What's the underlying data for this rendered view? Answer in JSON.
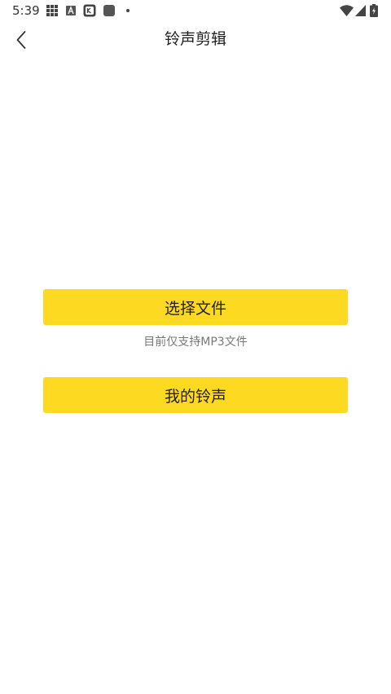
{
  "status_bar": {
    "time": "5:39",
    "left_icons": [
      "grid-icon",
      "a-notification-icon",
      "app-notification-icon",
      "square-notification-icon",
      "dot-icon"
    ],
    "right_icons": [
      "wifi-icon",
      "signal-icon",
      "battery-charging-icon"
    ]
  },
  "header": {
    "back_icon": "chevron-left-icon",
    "title": "铃声剪辑"
  },
  "main": {
    "select_file_label": "选择文件",
    "hint": "目前仅支持MP3文件",
    "my_ringtones_label": "我的铃声"
  },
  "colors": {
    "accent": "#FDD922",
    "background": "#FFFFFF",
    "text": "#222222",
    "hint_text": "#777777"
  }
}
